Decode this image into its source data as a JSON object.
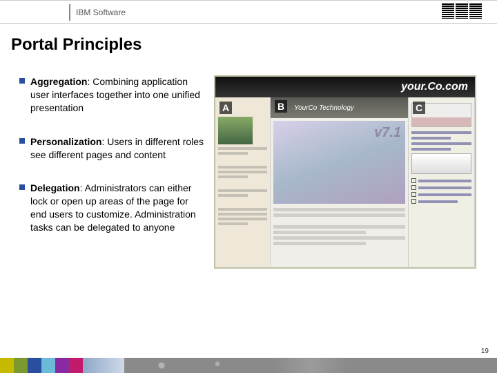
{
  "header": {
    "label": "IBM Software",
    "logo_name": "IBM"
  },
  "title": "Portal Principles",
  "bullets": [
    {
      "term": "Aggregation",
      "desc": ":  Combining application user interfaces together into one unified presentation"
    },
    {
      "term": "Personalization",
      "desc": ":  Users in different roles see different pages and content"
    },
    {
      "term": "Delegation",
      "desc": ":  Administrators can either lock or open up areas of the page for end users to customize.  Administration tasks can be delegated to anyone"
    }
  ],
  "mock": {
    "brand": "your.Co.com",
    "hero_subbrand": "YourCo Technology",
    "labels": {
      "a": "A",
      "b": "B",
      "c": "C"
    }
  },
  "page_number": "19"
}
